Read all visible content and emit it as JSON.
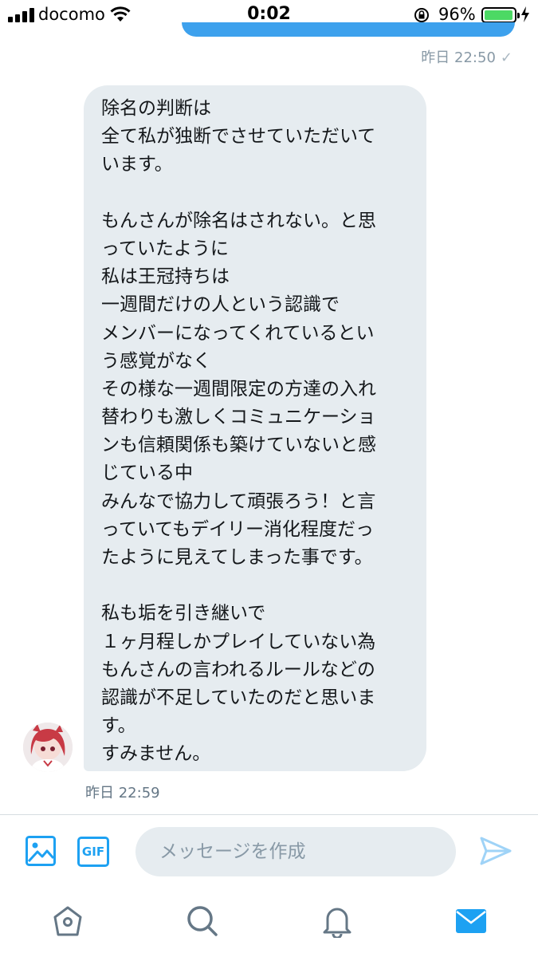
{
  "status_bar": {
    "carrier": "docomo",
    "time": "0:02",
    "battery_percent": "96%",
    "battery_level": 0.96
  },
  "previous_message": {
    "timestamp": "昨日 22:50",
    "read_mark": "✓"
  },
  "message": {
    "lines": [
      "除名の判断は",
      "全て私が独断でさせていただいて",
      "います。",
      "",
      "もんさんが除名はされない。と思",
      "っていたように",
      "私は王冠持ちは",
      "一週間だけの人という認識で",
      "メンバーになってくれているとい",
      "う感覚がなく",
      "その様な一週間限定の方達の入れ",
      "替わりも激しくコミュニケーショ",
      "ンも信頼関係も築けていないと感",
      "じている中",
      "みんなで協力して頑張ろう！と言",
      "っていてもデイリー消化程度だっ",
      "たように見えてしまった事です。",
      "",
      "私も垢を引き継いで",
      "１ヶ月程しかプレイしていない為",
      "もんさんの言われるルールなどの",
      "認識が不足していたのだと思いま",
      "す。",
      "すみません。"
    ],
    "timestamp": "昨日 22:59"
  },
  "composer": {
    "gif_label": "GIF",
    "placeholder": "メッセージを作成"
  },
  "icons": {
    "image": "image-icon",
    "send": "send-icon",
    "home": "home-icon",
    "search": "search-icon",
    "notifications": "bell-icon",
    "messages": "mail-icon"
  },
  "colors": {
    "accent": "#1da1f2",
    "bubble_incoming": "#e6ecf0",
    "bubble_outgoing": "#3da1ed",
    "battery": "#4cd964",
    "muted": "#8899a6"
  }
}
